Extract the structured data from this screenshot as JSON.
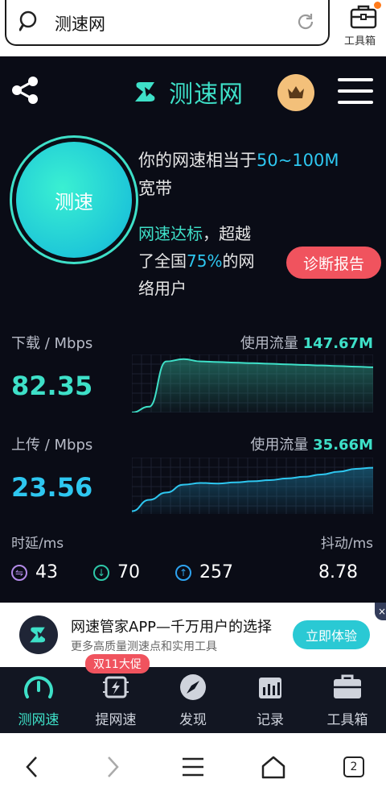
{
  "browser": {
    "search_text": "测速网",
    "toolbox_label": "工具箱",
    "tabs_count": "2"
  },
  "header": {
    "logo_text": "测速网"
  },
  "test": {
    "button_label": "测速"
  },
  "result": {
    "line1_prefix": "你的网速相当于",
    "line1_value": "50~100M",
    "line1_suffix": "宽带",
    "status": "网速达标",
    "line2_a": "，超越",
    "line2_b": "了全国",
    "percent": "75%",
    "line2_c": "的网",
    "line2_d": "络用户",
    "diagnose_label": "诊断报告"
  },
  "download": {
    "label": "下载 / Mbps",
    "value": "82.35",
    "traffic_label": "使用流量",
    "traffic_value": "147.67M",
    "trend": [
      0,
      0.1,
      0.88,
      0.92,
      0.88,
      0.87,
      0.86,
      0.85,
      0.84,
      0.83,
      0.82,
      0.81,
      0.8,
      0.79,
      0.78
    ]
  },
  "upload": {
    "label": "上传 / Mbps",
    "value": "23.56",
    "traffic_label": "使用流量",
    "traffic_value": "35.66M",
    "trend": [
      0.05,
      0.25,
      0.38,
      0.52,
      0.55,
      0.54,
      0.56,
      0.58,
      0.6,
      0.63,
      0.66,
      0.7,
      0.75,
      0.8,
      0.82
    ]
  },
  "latency": {
    "label": "时延/ms",
    "jitter_label": "抖动/ms",
    "ping": "43",
    "down_ms": "70",
    "up_ms": "257",
    "jitter": "8.78"
  },
  "ad": {
    "title": "网速管家APP—千万用户的选择",
    "subtitle": "更多高质量测速点和实用工具",
    "button": "立即体验",
    "close": "×"
  },
  "nav": {
    "promo": "双11大促",
    "items": [
      {
        "label": "测网速",
        "icon": "gauge-icon"
      },
      {
        "label": "提网速",
        "icon": "chip-bolt-icon"
      },
      {
        "label": "发现",
        "icon": "compass-icon"
      },
      {
        "label": "记录",
        "icon": "record-chart-icon"
      },
      {
        "label": "工具箱",
        "icon": "toolbox-icon"
      }
    ]
  },
  "colors": {
    "accent": "#3ee0c8",
    "blue": "#2ec7f0",
    "danger": "#f0535e",
    "background": "#0a0c16"
  }
}
